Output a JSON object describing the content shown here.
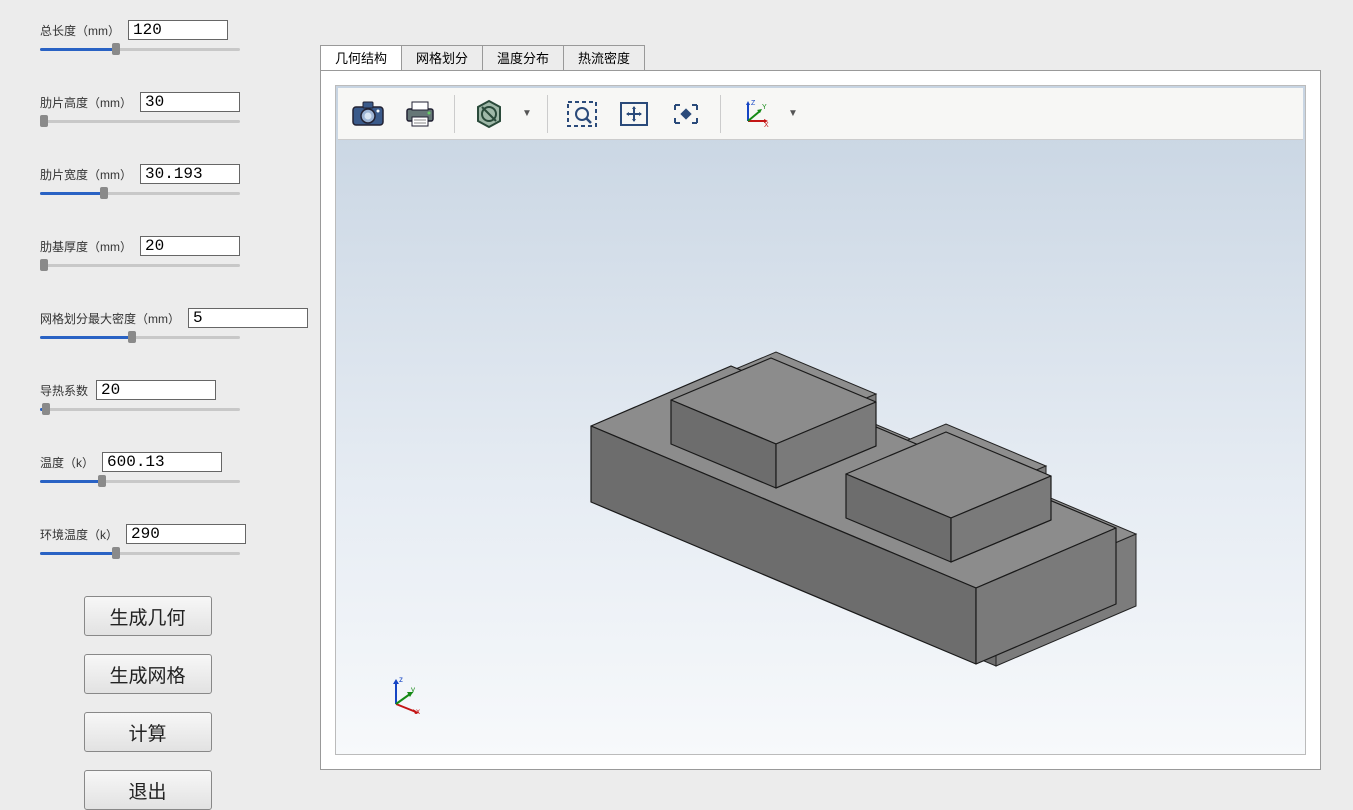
{
  "params": [
    {
      "label": "总长度（mm）",
      "value": "120",
      "sliderPct": 38,
      "inputClass": ""
    },
    {
      "label": "肋片高度（mm）",
      "value": "30",
      "sliderPct": 2,
      "inputClass": ""
    },
    {
      "label": "肋片宽度（mm）",
      "value": "30.193",
      "sliderPct": 32,
      "inputClass": ""
    },
    {
      "label": "肋基厚度（mm）",
      "value": "20",
      "sliderPct": 2,
      "inputClass": ""
    },
    {
      "label": "网格划分最大密度（mm）",
      "value": "5",
      "sliderPct": 46,
      "inputClass": "wide"
    },
    {
      "label": "导热系数",
      "value": "20",
      "sliderPct": 3,
      "inputClass": "wide"
    },
    {
      "label": "温度（k）",
      "value": "600.13",
      "sliderPct": 31,
      "inputClass": "wide"
    },
    {
      "label": "环境温度（k）",
      "value": "290",
      "sliderPct": 38,
      "inputClass": "wide"
    }
  ],
  "buttons": {
    "gen_geom": "生成几何",
    "gen_mesh": "生成网格",
    "compute": "计算",
    "exit": "退出"
  },
  "tabs": [
    "几何结构",
    "网格划分",
    "温度分布",
    "热流密度"
  ],
  "activeTab": 0,
  "toolbar": {
    "camera": "camera-icon",
    "print": "print-icon",
    "hex": "hex-icon",
    "zoom": "zoom-box-icon",
    "pan": "pan-icon",
    "fit": "fit-icon",
    "axes": "axes-icon"
  },
  "axes": {
    "x": "x",
    "y": "y",
    "z": "z"
  }
}
